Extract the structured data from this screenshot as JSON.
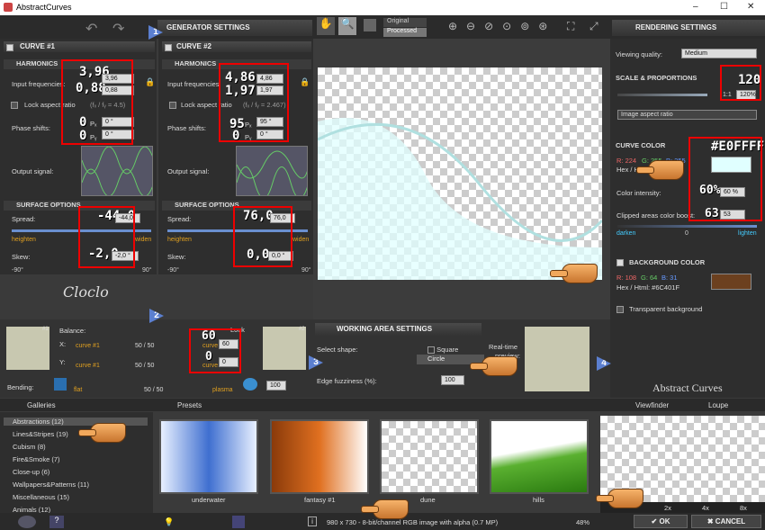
{
  "window": {
    "title": "AbstractCurves",
    "min": "–",
    "max": "☐",
    "close": "✕"
  },
  "generator": {
    "title": "GENERATOR SETTINGS",
    "curve1": "CURVE #1",
    "curve2": "CURVE #2"
  },
  "harmonics": {
    "label": "HARMONICS",
    "input_freq": "Input frequencies:",
    "lock": "Lock aspect ratio",
    "lock1_ratio": "(fₓ / fᵧ = 4.5)",
    "lock2_ratio": "(fₓ / fᵧ = 2.467)",
    "phase": "Phase shifts:",
    "output": "Output signal:"
  },
  "curve1": {
    "fx_big": "3,96",
    "fy_big": "0,88",
    "fx": "3,96",
    "fy": "0,88",
    "px_big": "0",
    "py_big": "0",
    "px": "0 °",
    "py": "0 °",
    "px_sub": "Pₓ",
    "py_sub": "Pᵧ"
  },
  "curve2": {
    "fx_big": "4,86",
    "fy_big": "1,97",
    "fx": "4,86",
    "fy": "1,97",
    "px_big": "95",
    "py_big": "0",
    "px": "95 °",
    "py": "0 °",
    "px_sub": "Pₓ",
    "py_sub": "Pᵧ"
  },
  "surface": {
    "label": "SURFACE OPTIONS",
    "spread": "Spread:",
    "skew": "Skew:",
    "heighten": "heighten",
    "widen": "widen",
    "neg90": "-90°",
    "pos90": "90°"
  },
  "surface1": {
    "spread_big": "-44,0",
    "spread": "-44,0",
    "skew_big": "-2,0",
    "skew": "-2,0 °"
  },
  "surface2": {
    "spread_big": "76,0",
    "spread": "76,0",
    "skew_big": "0,0",
    "skew": "0,0 °"
  },
  "balance": {
    "label": "Balance:",
    "x": "X:",
    "y": "Y:",
    "c1": "curve #1",
    "c2": "curve #2",
    "xv": "50 / 50",
    "yv": "50 / 50",
    "lock": "Lock",
    "xbig": "60",
    "ybig": "0",
    "xf": "60",
    "yf": "0",
    "bend": "Bending:",
    "flat": "flat",
    "plasma": "plasma",
    "bv": "50 / 50",
    "bf": "100",
    "n1": "#1",
    "n2": "#2"
  },
  "preview": {
    "original": "Original",
    "processed": "Processed"
  },
  "working": {
    "title": "WORKING AREA SETTINGS",
    "shape": "Select shape:",
    "square": "Square",
    "circle": "Circle",
    "rt": "Real-time",
    "pv": "preview:",
    "fuzz": "Edge fuzziness (%):",
    "fuzzv": "100"
  },
  "rendering": {
    "title": "RENDERING SETTINGS",
    "quality_label": "Viewing quality:",
    "quality": "Medium",
    "scale": "SCALE & PROPORTIONS",
    "scale_big": "120",
    "one": "1:1",
    "pct": "120%",
    "aspect": "Image aspect ratio",
    "curve_color": "CURVE COLOR",
    "hex_big": "#E0FFFF",
    "r": "R: 224",
    "g": "G: 255",
    "b": "B: 255",
    "hex": "Hex / Html: #E0FFFF",
    "intensity": "Color intensity:",
    "int_big": "60%",
    "int": "60 %",
    "clipped": "Clipped areas color boost:",
    "clip_big": "63",
    "clip": "53",
    "darken": "darken",
    "zero": "0",
    "lighten": "lighten",
    "bg": "BACKGROUND COLOR",
    "br": "R: 108",
    "bgg": "G: 64",
    "bb": "B: 31",
    "bhex": "Hex / Html: #6C401F",
    "transparent": "Transparent background",
    "logo": "Abstract Curves"
  },
  "galleries": {
    "title": "Galleries",
    "items": [
      "Abstractions (12)",
      "Lines&Stripes (19)",
      "Cubism (8)",
      "Fire&Smoke (7)",
      "Close-up (6)",
      "Wallpapers&Patterns (11)",
      "Miscellaneous (15)",
      "Animals (12)"
    ]
  },
  "presets": {
    "title": "Presets",
    "names": [
      "underwater",
      "fantasy #1",
      "dune",
      "hills"
    ]
  },
  "viewfinder": {
    "title": "Viewfinder",
    "loupe": "Loupe",
    "z2": "2x",
    "z4": "4x",
    "z8": "8x"
  },
  "status": {
    "info": "980 x 730 - 8-bit/channel RGB image with alpha (0.7 MP)",
    "zoom": "48%"
  },
  "buttons": {
    "ok": "OK",
    "cancel": "CANCEL"
  },
  "steps": {
    "s1": "1",
    "s2": "2",
    "s3": "3",
    "s4": "4"
  },
  "colors": {
    "accent": "#5b7fd0",
    "curve": "#E0FFFF",
    "bg": "#6C401F",
    "highlight": "#e00000"
  }
}
